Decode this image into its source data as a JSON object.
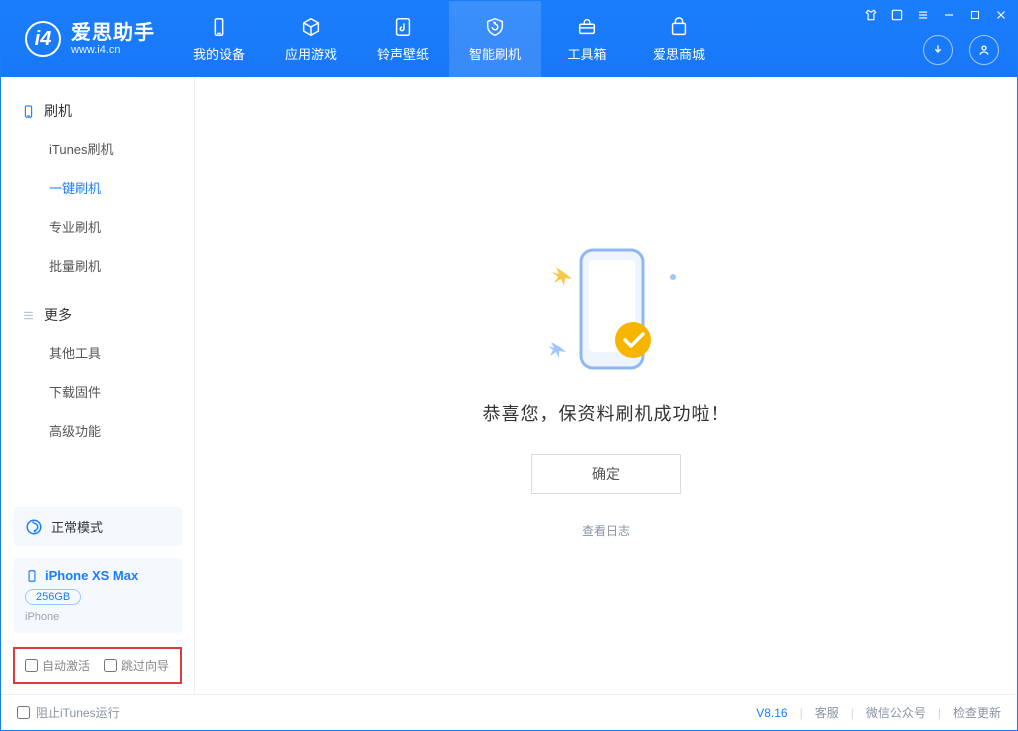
{
  "app": {
    "title": "爱思助手",
    "subtitle": "www.i4.cn"
  },
  "nav": {
    "items": [
      {
        "label": "我的设备"
      },
      {
        "label": "应用游戏"
      },
      {
        "label": "铃声壁纸"
      },
      {
        "label": "智能刷机"
      },
      {
        "label": "工具箱"
      },
      {
        "label": "爱思商城"
      }
    ],
    "active_index": 3
  },
  "sidebar": {
    "groups": [
      {
        "title": "刷机",
        "items": [
          "iTunes刷机",
          "一键刷机",
          "专业刷机",
          "批量刷机"
        ],
        "active_index": 1
      },
      {
        "title": "更多",
        "items": [
          "其他工具",
          "下载固件",
          "高级功能"
        ],
        "active_index": -1
      }
    ],
    "mode": "正常模式",
    "device": {
      "name": "iPhone XS Max",
      "capacity": "256GB",
      "type": "iPhone"
    },
    "options": {
      "auto_activate": "自动激活",
      "skip_guide": "跳过向导"
    }
  },
  "main": {
    "message": "恭喜您，保资料刷机成功啦！",
    "confirm": "确定",
    "log_link": "查看日志"
  },
  "footer": {
    "block_itunes": "阻止iTunes运行",
    "version": "V8.16",
    "links": [
      "客服",
      "微信公众号",
      "检查更新"
    ]
  }
}
